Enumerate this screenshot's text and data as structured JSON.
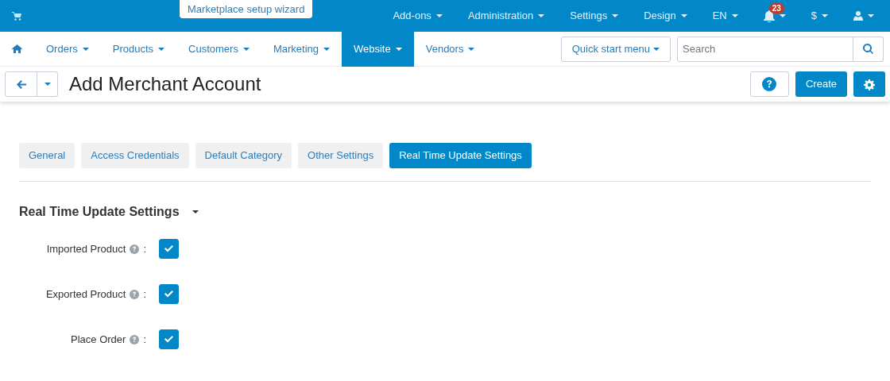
{
  "top_bar": {
    "wizard_link": "Marketplace setup wizard",
    "menus": [
      {
        "label": "Add-ons"
      },
      {
        "label": "Administration"
      },
      {
        "label": "Settings"
      },
      {
        "label": "Design"
      },
      {
        "label": "EN"
      }
    ],
    "notifications": {
      "count": "23"
    },
    "currency": "$"
  },
  "main_nav": {
    "items": [
      {
        "label": "Orders",
        "selected": false
      },
      {
        "label": "Products",
        "selected": false
      },
      {
        "label": "Customers",
        "selected": false
      },
      {
        "label": "Marketing",
        "selected": false
      },
      {
        "label": "Website",
        "selected": true
      },
      {
        "label": "Vendors",
        "selected": false
      }
    ],
    "quick_start": "Quick start menu",
    "search": {
      "placeholder": "Search"
    }
  },
  "toolbar": {
    "title": "Add Merchant Account",
    "create_button": "Create"
  },
  "tabs": [
    {
      "label": "General",
      "selected": false
    },
    {
      "label": "Access Credentials",
      "selected": false
    },
    {
      "label": "Default Category",
      "selected": false
    },
    {
      "label": "Other Settings",
      "selected": false
    },
    {
      "label": "Real Time Update Settings",
      "selected": true
    }
  ],
  "section": {
    "title": "Real Time Update Settings",
    "expanded": true,
    "fields": [
      {
        "label": "Imported Product",
        "suffix": ":",
        "checked": true
      },
      {
        "label": "Exported Product",
        "suffix": ":",
        "checked": true
      },
      {
        "label": "Place Order",
        "suffix": ":",
        "checked": true
      }
    ]
  }
}
